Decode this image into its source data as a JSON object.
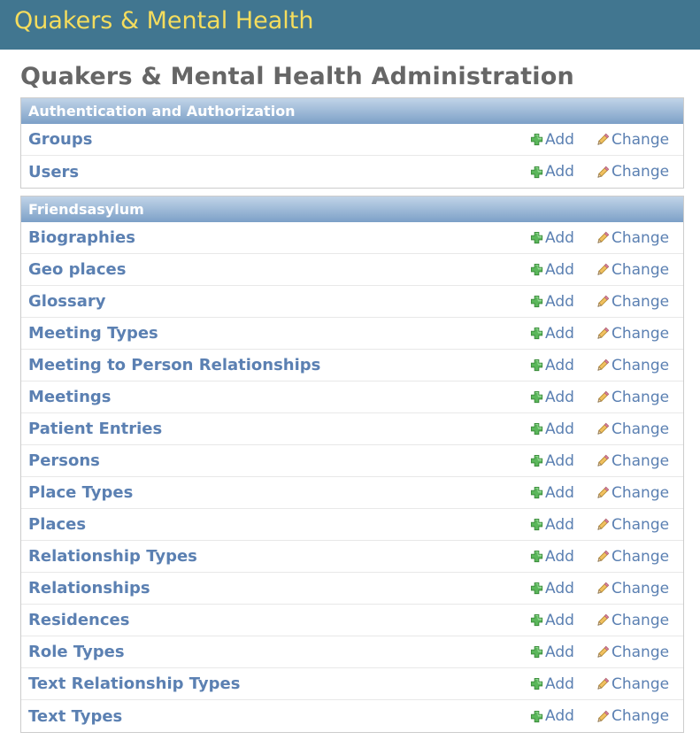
{
  "header": {
    "site_name": "Quakers & Mental Health"
  },
  "page": {
    "title": "Quakers & Mental Health Administration"
  },
  "link_labels": {
    "add": "Add",
    "change": "Change"
  },
  "colors": {
    "header_bg": "#417690",
    "site_name": "#f5dd5d",
    "caption_gradient_top": "#c1d4e8",
    "caption_gradient_bottom": "#7ca0c7",
    "link": "#5b80b2",
    "title": "#666666"
  },
  "icons": {
    "add": "plus-icon",
    "change": "pencil-icon"
  },
  "modules": [
    {
      "caption": "Authentication and Authorization",
      "models": [
        "Groups",
        "Users"
      ]
    },
    {
      "caption": "Friendsasylum",
      "models": [
        "Biographies",
        "Geo places",
        "Glossary",
        "Meeting Types",
        "Meeting to Person Relationships",
        "Meetings",
        "Patient Entries",
        "Persons",
        "Place Types",
        "Places",
        "Relationship Types",
        "Relationships",
        "Residences",
        "Role Types",
        "Text Relationship Types",
        "Text Types"
      ]
    }
  ]
}
